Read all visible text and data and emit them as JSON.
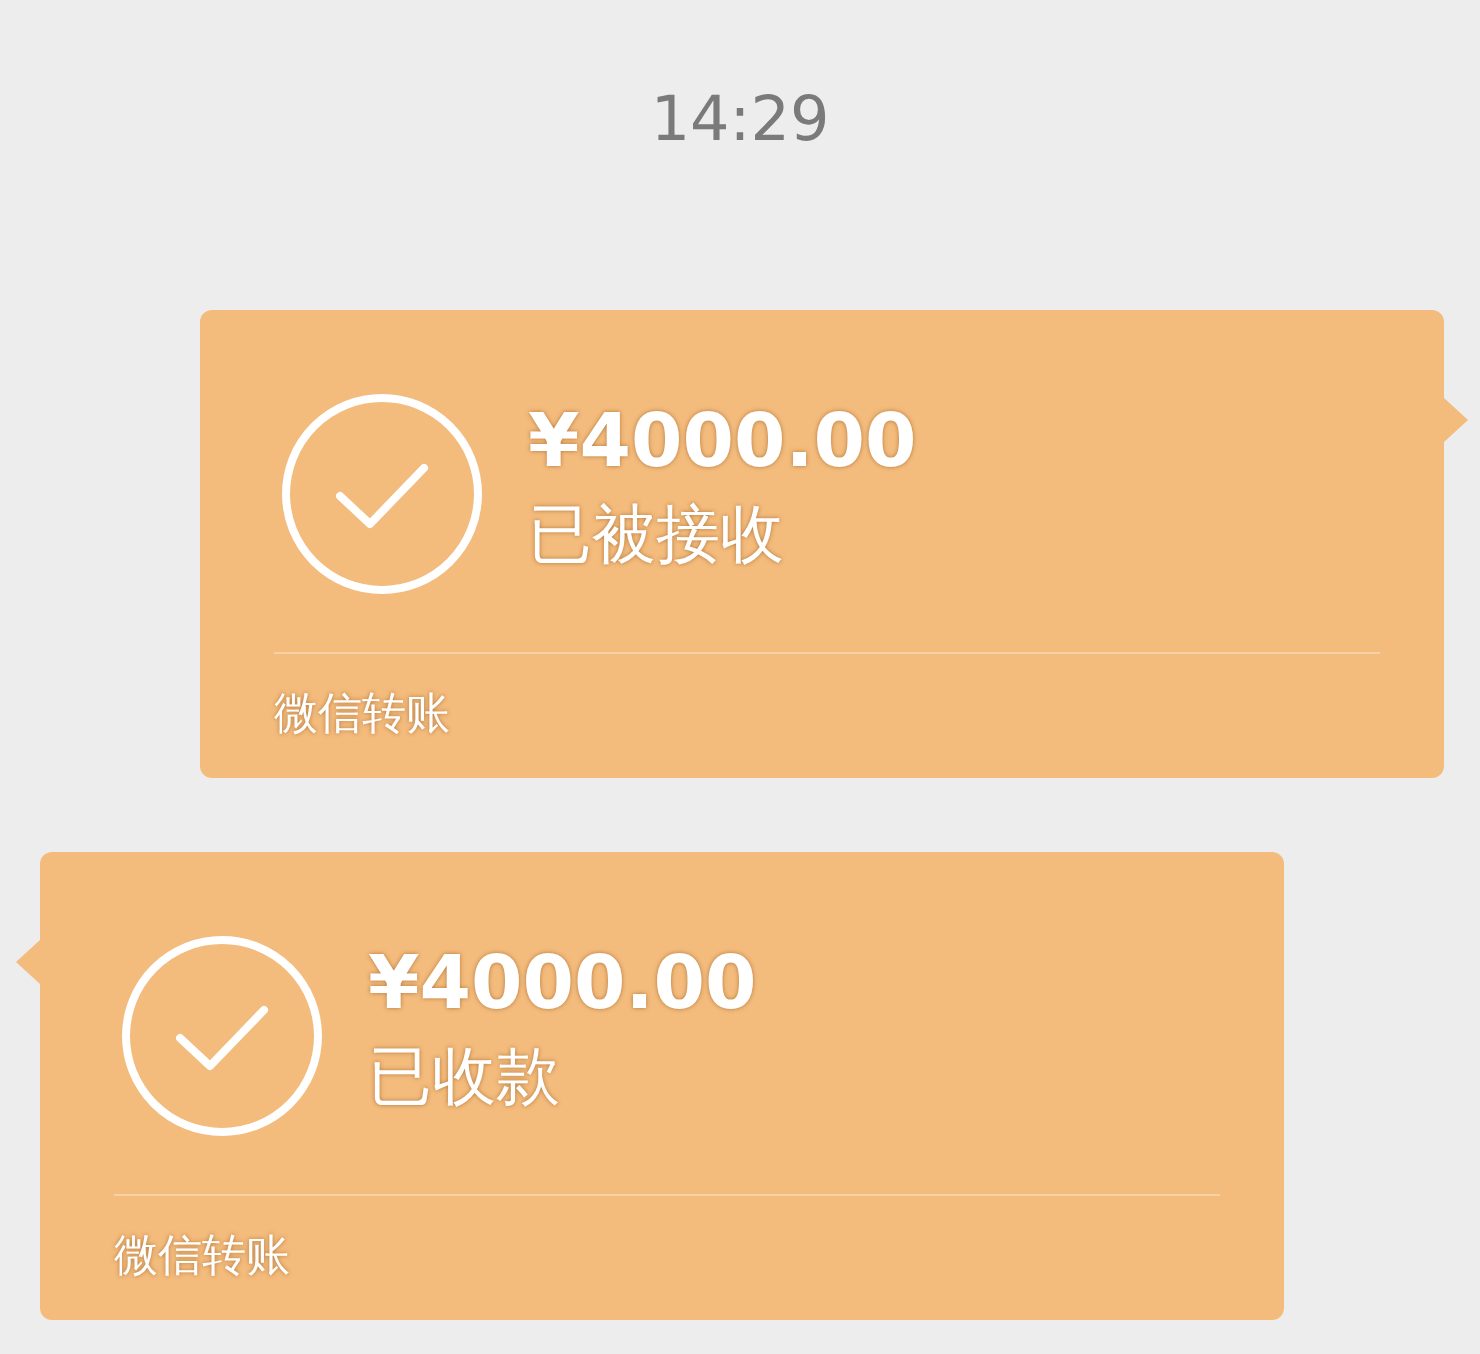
{
  "time": "14:29",
  "messages": [
    {
      "kind": "sent",
      "amount": "¥4000.00",
      "status": "已被接收",
      "footer": "微信转账"
    },
    {
      "kind": "received",
      "amount": "¥4000.00",
      "status": "已收款",
      "footer": "微信转账"
    }
  ]
}
